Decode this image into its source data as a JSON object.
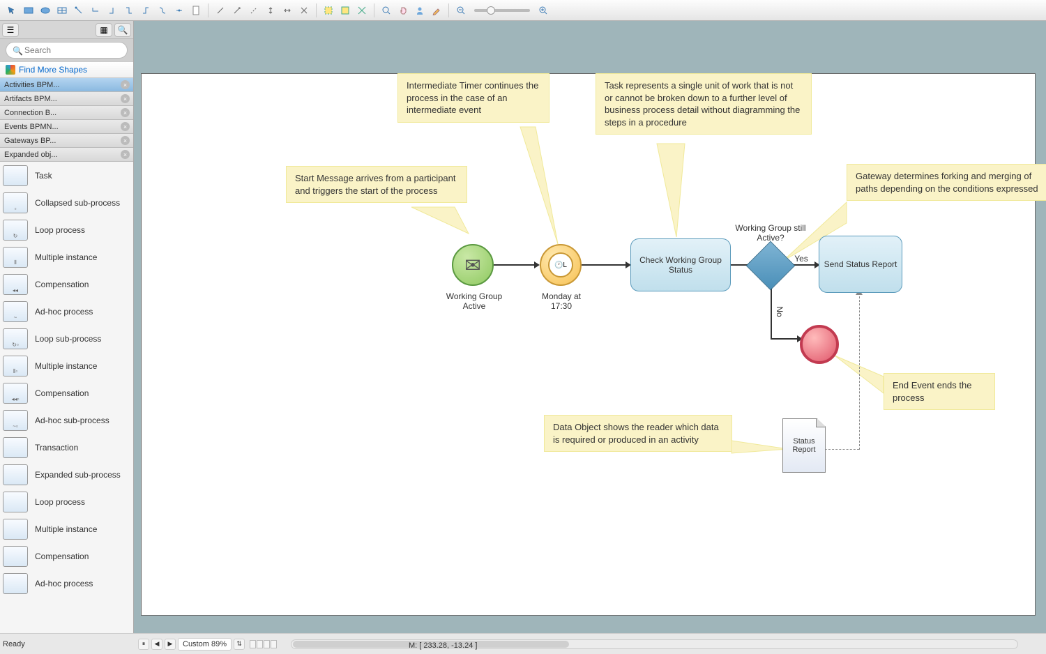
{
  "toolbar": {
    "groups": [
      [
        "pointer",
        "rect",
        "ellipse",
        "grid",
        "connector-1",
        "connector-2",
        "connector-3",
        "connector-4",
        "connector-5",
        "connector-6",
        "connector-7",
        "page"
      ],
      [
        "line-1",
        "line-2",
        "line-3",
        "line-4",
        "line-bidir",
        "line-multi"
      ],
      [
        "highlight-1",
        "highlight-2",
        "highlight-3"
      ],
      [
        "zoom-in",
        "pan",
        "user",
        "pencil"
      ],
      [
        "zoom-out-btn",
        "slider",
        "zoom-in-btn"
      ]
    ]
  },
  "sidebar": {
    "search_placeholder": "Search",
    "find_more": "Find More Shapes",
    "categories": [
      {
        "label": "Activities BPM...",
        "active": true
      },
      {
        "label": "Artifacts BPM...",
        "active": false
      },
      {
        "label": "Connection B...",
        "active": false
      },
      {
        "label": "Events BPMN...",
        "active": false
      },
      {
        "label": "Gateways BP...",
        "active": false
      },
      {
        "label": "Expanded obj...",
        "active": false
      }
    ],
    "shapes": [
      {
        "label": "Task",
        "badge": ""
      },
      {
        "label": "Collapsed sub-process",
        "badge": "▫"
      },
      {
        "label": "Loop process",
        "badge": "↻"
      },
      {
        "label": "Multiple instance",
        "badge": "⦀"
      },
      {
        "label": "Compensation",
        "badge": "◂◂"
      },
      {
        "label": "Ad-hoc process",
        "badge": "~"
      },
      {
        "label": "Loop sub-process",
        "badge": "↻▫"
      },
      {
        "label": "Multiple instance",
        "badge": "⦀▫"
      },
      {
        "label": "Compensation",
        "badge": "◂◂▫"
      },
      {
        "label": "Ad-hoc sub-process",
        "badge": "~▫"
      },
      {
        "label": "Transaction",
        "badge": ""
      },
      {
        "label": "Expanded sub-process",
        "badge": ""
      },
      {
        "label": "Loop process",
        "badge": ""
      },
      {
        "label": "Multiple instance",
        "badge": ""
      },
      {
        "label": "Compensation",
        "badge": ""
      },
      {
        "label": "Ad-hoc process",
        "badge": ""
      }
    ]
  },
  "diagram": {
    "callouts": {
      "start_msg": "Start Message arrives from a participant and triggers the start of the process",
      "timer": "Intermediate Timer continues the process in the case of an intermediate event",
      "task": "Task represents a single unit of work that is not or cannot be broken down to a further level of business process detail without diagramming the steps in a procedure",
      "gateway": "Gateway determines forking and merging of paths depending on the conditions expressed",
      "end": "End Event ends the process",
      "data": "Data Object shows the reader which data is required or produced in an activity"
    },
    "start_label": "Working Group Active",
    "timer_label": "Monday at 17:30",
    "task1": "Check Working Group Status",
    "gateway_label": "Working Group still Active?",
    "yes": "Yes",
    "no": "No",
    "task2": "Send Status Report",
    "doc": "Status Report"
  },
  "status": {
    "ready": "Ready",
    "zoom": "Custom 89%",
    "mouse": "M: [ 233.28, -13.24 ]"
  }
}
